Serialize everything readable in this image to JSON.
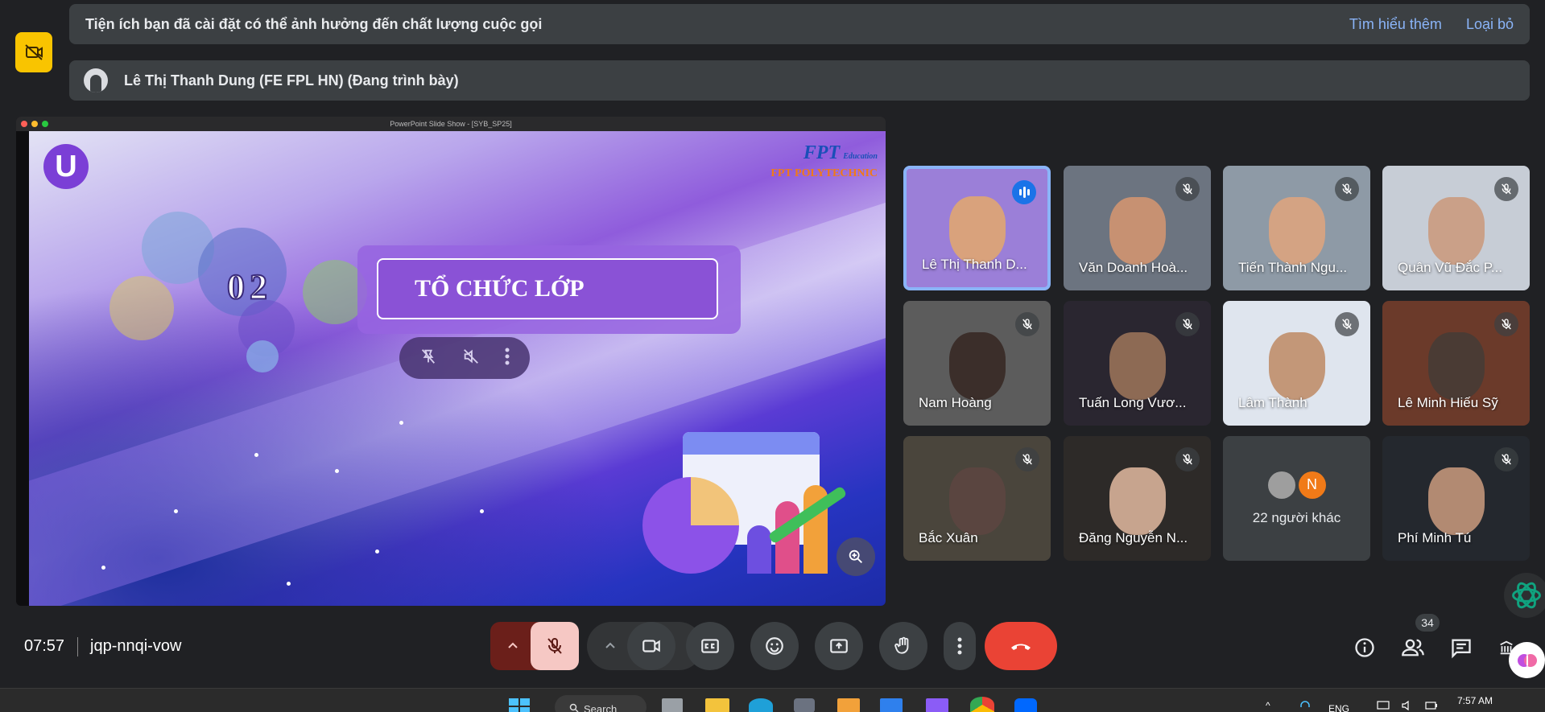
{
  "banner": {
    "message": "Tiện ích bạn đã cài đặt có thể ảnh hưởng đến chất lượng cuộc gọi",
    "learn_more": "Tìm hiểu thêm",
    "dismiss": "Loại bỏ"
  },
  "presenter": {
    "label": "Lê Thị Thanh Dung (FE FPL HN) (Đang trình bày)"
  },
  "presentation": {
    "window_title": "PowerPoint Slide Show - [SYB_SP25]",
    "slide_number": "02",
    "slide_title": "TỔ CHỨC LỚP",
    "brand_mark": "FPT",
    "brand_sub": "Education",
    "brand_school": "FPT POLYTECHNIC",
    "logo_letter": "U"
  },
  "participants": [
    {
      "name": "Lê Thị Thanh D...",
      "muted": false,
      "speaking": true
    },
    {
      "name": "Văn Doanh Hoà...",
      "muted": true
    },
    {
      "name": "Tiến Thành Ngu...",
      "muted": true
    },
    {
      "name": "Quân Vũ Đắc P...",
      "muted": true
    },
    {
      "name": "Nam Hoàng",
      "muted": true
    },
    {
      "name": "Tuấn Long Vươ...",
      "muted": true
    },
    {
      "name": "Lâm Thành",
      "muted": true
    },
    {
      "name": "Lê Minh Hiếu Sỹ",
      "muted": true
    },
    {
      "name": "Bắc Xuân",
      "muted": true
    },
    {
      "name": "Đăng Nguyễn N...",
      "muted": true
    },
    {
      "name": "22 người khác",
      "others_avatar_letter": "N"
    },
    {
      "name": "Phí Minh Tú",
      "muted": true
    }
  ],
  "meeting": {
    "time": "07:57",
    "code": "jqp-nnqi-vow",
    "participant_count": "34"
  },
  "taskbar": {
    "search_label": "Search",
    "language": "ENG",
    "clock": "7:57 AM"
  },
  "colors": {
    "background": "#202124",
    "banner": "#3c4043",
    "link": "#8ab4f8",
    "end_call": "#ea4335",
    "mic_off": "#f6c8c4",
    "warning_badge": "#f9c400"
  }
}
